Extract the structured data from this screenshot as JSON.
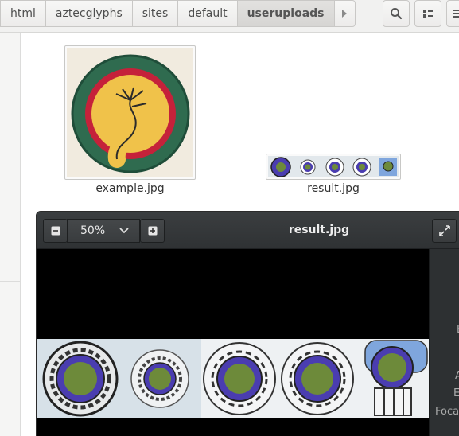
{
  "path_bar": {
    "crumbs": [
      "html",
      "aztecglyphs",
      "sites",
      "default",
      "useruploads"
    ],
    "active_crumb": "useruploads"
  },
  "toolbar": {
    "search_icon": "search-icon",
    "view_icon": "list-view-icon",
    "menu_icon": "menu-icon"
  },
  "files": [
    {
      "name": "example.jpg"
    },
    {
      "name": "result.jpg"
    }
  ],
  "preview": {
    "zoom_value": "50%",
    "title": "result.jpg",
    "side_labels": [
      "E",
      "A",
      "E",
      "Foca"
    ]
  },
  "colors": {
    "glyph_green": "#2f6b4f",
    "glyph_red": "#c5213a",
    "glyph_yellow": "#f0c24a",
    "glyph_blue": "#4a3db0",
    "glyph_moss": "#6d8a3a"
  }
}
